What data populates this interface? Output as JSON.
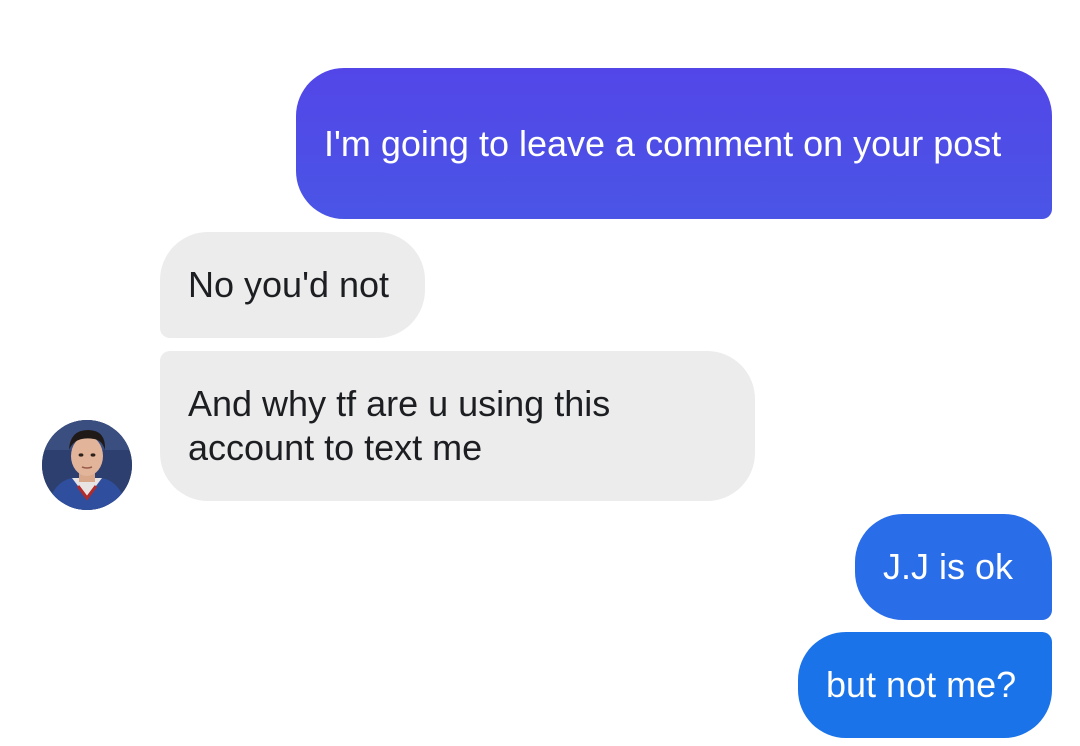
{
  "conversation": {
    "messages": [
      {
        "sender": "me",
        "text": "I'm going to leave a comment on your post"
      },
      {
        "sender": "contact",
        "text": "No you'd not"
      },
      {
        "sender": "contact",
        "text": "And why tf are u using this account to text me"
      },
      {
        "sender": "me",
        "text": "J.J is ok"
      },
      {
        "sender": "me",
        "text": "but not me?"
      }
    ]
  },
  "contact": {
    "avatar_icon": "profile-photo-avatar"
  },
  "colors": {
    "sent_bubble_top": "#5346e8",
    "sent_bubble_blue": "#1a73e8",
    "received_bubble": "#ececec",
    "received_text": "#1c1e21",
    "sent_text": "#ffffff"
  }
}
